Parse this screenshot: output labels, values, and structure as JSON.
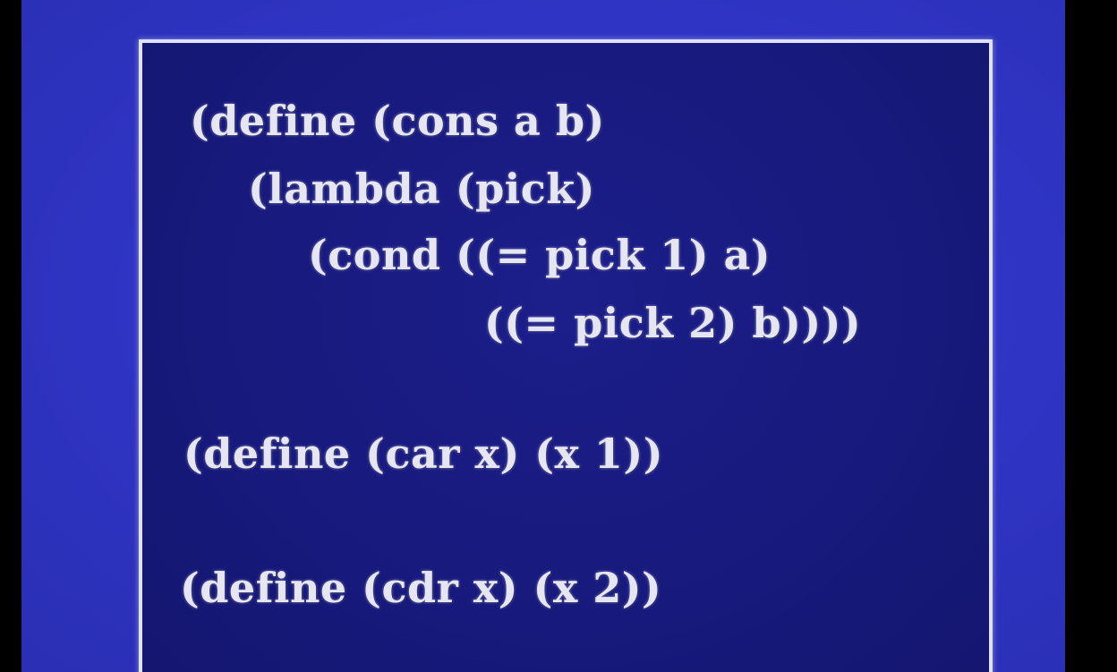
{
  "slide": {
    "lines": [
      "(define (cons a b)",
      "(lambda (pick)",
      "(cond ((= pick 1) a)",
      "((= pick 2) b))))",
      "(define (car x) (x 1))",
      "(define (cdr x) (x 2))"
    ]
  },
  "colors": {
    "outer_background": "#2f34c4",
    "slide_background": "#17197c",
    "border": "#dfe2ff",
    "text": "#e6e6f2",
    "letterbox": "#000000"
  }
}
